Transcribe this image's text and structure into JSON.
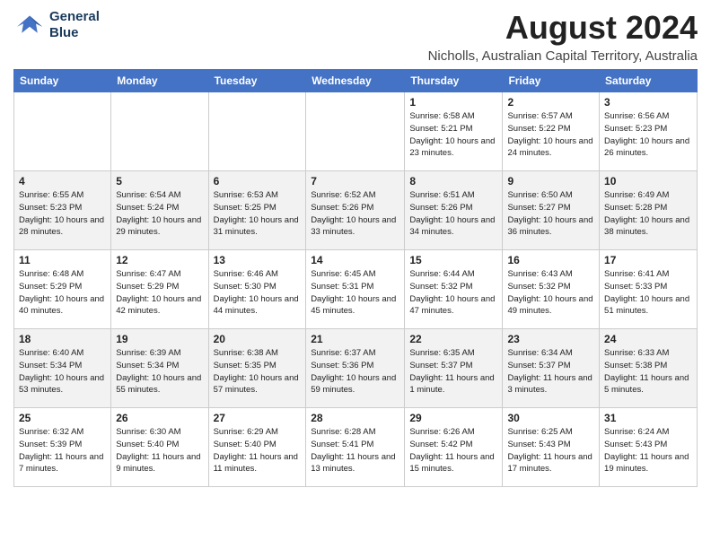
{
  "logo": {
    "line1": "General",
    "line2": "Blue"
  },
  "title": "August 2024",
  "subtitle": "Nicholls, Australian Capital Territory, Australia",
  "days_of_week": [
    "Sunday",
    "Monday",
    "Tuesday",
    "Wednesday",
    "Thursday",
    "Friday",
    "Saturday"
  ],
  "weeks": [
    [
      {
        "day": "",
        "info": ""
      },
      {
        "day": "",
        "info": ""
      },
      {
        "day": "",
        "info": ""
      },
      {
        "day": "",
        "info": ""
      },
      {
        "day": "1",
        "info": "Sunrise: 6:58 AM\nSunset: 5:21 PM\nDaylight: 10 hours\nand 23 minutes."
      },
      {
        "day": "2",
        "info": "Sunrise: 6:57 AM\nSunset: 5:22 PM\nDaylight: 10 hours\nand 24 minutes."
      },
      {
        "day": "3",
        "info": "Sunrise: 6:56 AM\nSunset: 5:23 PM\nDaylight: 10 hours\nand 26 minutes."
      }
    ],
    [
      {
        "day": "4",
        "info": "Sunrise: 6:55 AM\nSunset: 5:23 PM\nDaylight: 10 hours\nand 28 minutes."
      },
      {
        "day": "5",
        "info": "Sunrise: 6:54 AM\nSunset: 5:24 PM\nDaylight: 10 hours\nand 29 minutes."
      },
      {
        "day": "6",
        "info": "Sunrise: 6:53 AM\nSunset: 5:25 PM\nDaylight: 10 hours\nand 31 minutes."
      },
      {
        "day": "7",
        "info": "Sunrise: 6:52 AM\nSunset: 5:26 PM\nDaylight: 10 hours\nand 33 minutes."
      },
      {
        "day": "8",
        "info": "Sunrise: 6:51 AM\nSunset: 5:26 PM\nDaylight: 10 hours\nand 34 minutes."
      },
      {
        "day": "9",
        "info": "Sunrise: 6:50 AM\nSunset: 5:27 PM\nDaylight: 10 hours\nand 36 minutes."
      },
      {
        "day": "10",
        "info": "Sunrise: 6:49 AM\nSunset: 5:28 PM\nDaylight: 10 hours\nand 38 minutes."
      }
    ],
    [
      {
        "day": "11",
        "info": "Sunrise: 6:48 AM\nSunset: 5:29 PM\nDaylight: 10 hours\nand 40 minutes."
      },
      {
        "day": "12",
        "info": "Sunrise: 6:47 AM\nSunset: 5:29 PM\nDaylight: 10 hours\nand 42 minutes."
      },
      {
        "day": "13",
        "info": "Sunrise: 6:46 AM\nSunset: 5:30 PM\nDaylight: 10 hours\nand 44 minutes."
      },
      {
        "day": "14",
        "info": "Sunrise: 6:45 AM\nSunset: 5:31 PM\nDaylight: 10 hours\nand 45 minutes."
      },
      {
        "day": "15",
        "info": "Sunrise: 6:44 AM\nSunset: 5:32 PM\nDaylight: 10 hours\nand 47 minutes."
      },
      {
        "day": "16",
        "info": "Sunrise: 6:43 AM\nSunset: 5:32 PM\nDaylight: 10 hours\nand 49 minutes."
      },
      {
        "day": "17",
        "info": "Sunrise: 6:41 AM\nSunset: 5:33 PM\nDaylight: 10 hours\nand 51 minutes."
      }
    ],
    [
      {
        "day": "18",
        "info": "Sunrise: 6:40 AM\nSunset: 5:34 PM\nDaylight: 10 hours\nand 53 minutes."
      },
      {
        "day": "19",
        "info": "Sunrise: 6:39 AM\nSunset: 5:34 PM\nDaylight: 10 hours\nand 55 minutes."
      },
      {
        "day": "20",
        "info": "Sunrise: 6:38 AM\nSunset: 5:35 PM\nDaylight: 10 hours\nand 57 minutes."
      },
      {
        "day": "21",
        "info": "Sunrise: 6:37 AM\nSunset: 5:36 PM\nDaylight: 10 hours\nand 59 minutes."
      },
      {
        "day": "22",
        "info": "Sunrise: 6:35 AM\nSunset: 5:37 PM\nDaylight: 11 hours\nand 1 minute."
      },
      {
        "day": "23",
        "info": "Sunrise: 6:34 AM\nSunset: 5:37 PM\nDaylight: 11 hours\nand 3 minutes."
      },
      {
        "day": "24",
        "info": "Sunrise: 6:33 AM\nSunset: 5:38 PM\nDaylight: 11 hours\nand 5 minutes."
      }
    ],
    [
      {
        "day": "25",
        "info": "Sunrise: 6:32 AM\nSunset: 5:39 PM\nDaylight: 11 hours\nand 7 minutes."
      },
      {
        "day": "26",
        "info": "Sunrise: 6:30 AM\nSunset: 5:40 PM\nDaylight: 11 hours\nand 9 minutes."
      },
      {
        "day": "27",
        "info": "Sunrise: 6:29 AM\nSunset: 5:40 PM\nDaylight: 11 hours\nand 11 minutes."
      },
      {
        "day": "28",
        "info": "Sunrise: 6:28 AM\nSunset: 5:41 PM\nDaylight: 11 hours\nand 13 minutes."
      },
      {
        "day": "29",
        "info": "Sunrise: 6:26 AM\nSunset: 5:42 PM\nDaylight: 11 hours\nand 15 minutes."
      },
      {
        "day": "30",
        "info": "Sunrise: 6:25 AM\nSunset: 5:43 PM\nDaylight: 11 hours\nand 17 minutes."
      },
      {
        "day": "31",
        "info": "Sunrise: 6:24 AM\nSunset: 5:43 PM\nDaylight: 11 hours\nand 19 minutes."
      }
    ]
  ]
}
